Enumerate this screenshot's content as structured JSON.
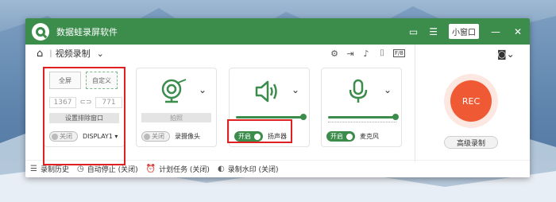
{
  "app": {
    "title": "数据蛙录屏软件"
  },
  "titlebar": {
    "mini_window_label": "小窗口",
    "minimize": "—",
    "close": "✕"
  },
  "toolbar": {
    "mode_label": "视频录制",
    "separator": "|"
  },
  "screen_card": {
    "fullscreen_label": "全屏",
    "custom_label": "自定义",
    "width": "1367",
    "height": "771",
    "exclude_window_label": "设置排除窗口",
    "toggle_label": "关闭",
    "display_label": "DISPLAY1 ▾"
  },
  "camera_card": {
    "photo_label": "拍照",
    "toggle_label": "关闭",
    "device_label": "录摄像头"
  },
  "speaker_card": {
    "toggle_label": "开启",
    "device_label": "扬声器",
    "volume_level": 1.0
  },
  "mic_card": {
    "toggle_label": "开启",
    "device_label": "麦克风",
    "volume_level": 1.0
  },
  "record": {
    "rec_label": "REC",
    "advanced_label": "高级录制"
  },
  "footer": {
    "history": "录制历史",
    "auto_stop": "自动停止 (关闭)",
    "schedule": "计划任务 (关闭)",
    "watermark": "录制水印 (关闭)"
  },
  "colors": {
    "accent": "#3c8c4c",
    "rec": "#ef5a35",
    "highlight": "#e02020"
  }
}
